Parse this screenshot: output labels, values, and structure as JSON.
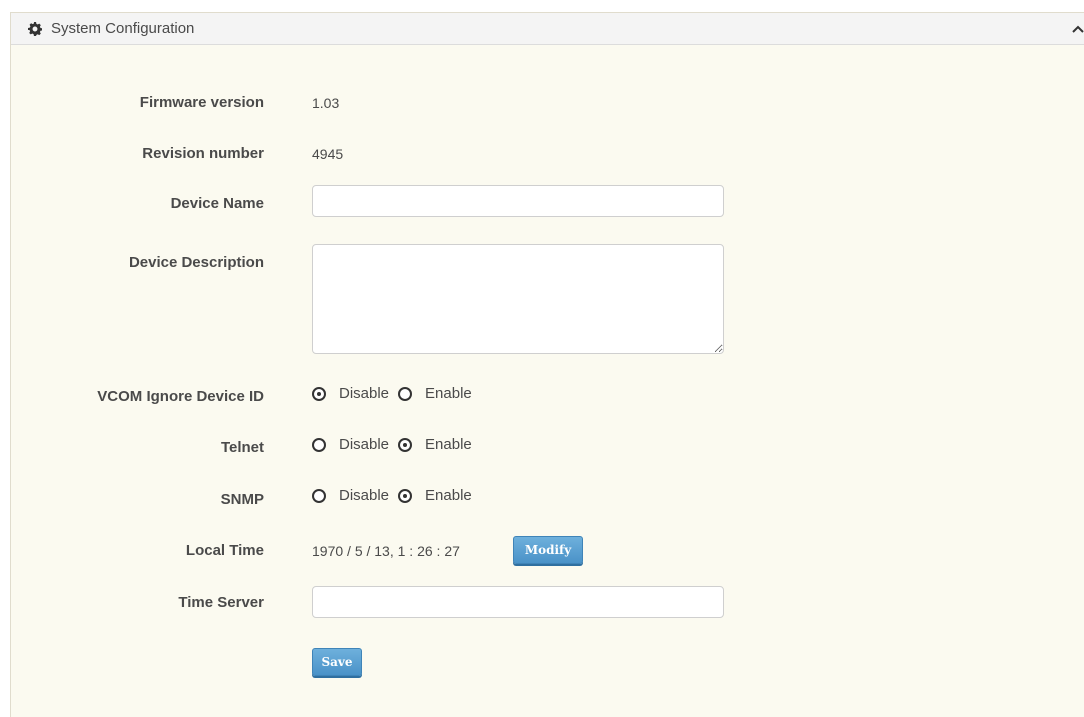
{
  "panel": {
    "title": "System Configuration",
    "icon": "gear-icon",
    "collapse_icon": "chevron-up-icon"
  },
  "fields": {
    "firmware_version": {
      "label": "Firmware version",
      "value": "1.03"
    },
    "revision_number": {
      "label": "Revision number",
      "value": "4945"
    },
    "device_name": {
      "label": "Device Name",
      "value": "",
      "placeholder": ""
    },
    "device_description": {
      "label": "Device Description",
      "value": ""
    },
    "vcom_ignore_device_id": {
      "label": "VCOM Ignore Device ID",
      "options": [
        {
          "label": "Disable",
          "checked": true
        },
        {
          "label": "Enable",
          "checked": false
        }
      ]
    },
    "telnet": {
      "label": "Telnet",
      "options": [
        {
          "label": "Disable",
          "checked": false
        },
        {
          "label": "Enable",
          "checked": true
        }
      ]
    },
    "snmp": {
      "label": "SNMP",
      "options": [
        {
          "label": "Disable",
          "checked": false
        },
        {
          "label": "Enable",
          "checked": true
        }
      ]
    },
    "local_time": {
      "label": "Local Time",
      "value": "1970 / 5 / 13, 1 : 26 : 27",
      "modify_label": "Modify"
    },
    "time_server": {
      "label": "Time Server",
      "value": "",
      "placeholder": ""
    }
  },
  "actions": {
    "save_label": "Save"
  },
  "colors": {
    "panel_background": "#fbfaf0",
    "header_background": "#f4f4f4",
    "button_primary": "#5aa0d4",
    "text": "#4a4a4a"
  }
}
